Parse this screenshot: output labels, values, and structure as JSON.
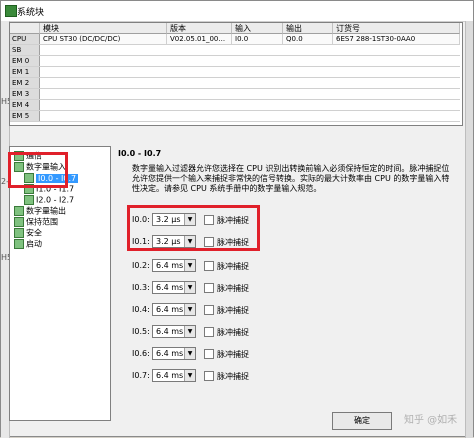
{
  "window": {
    "title": "系统块"
  },
  "left_edge": {
    "marks": [
      "H5",
      "2-",
      "H5"
    ]
  },
  "module_table": {
    "headers": [
      "模块",
      "版本",
      "输入",
      "输出",
      "订货号"
    ],
    "rows": [
      {
        "label": "CPU",
        "module": "CPU ST30 (DC/DC/DC)",
        "version": "V02.05.01_00...",
        "input": "I0.0",
        "output": "Q0.0",
        "order": "6ES7 288-1ST30-0AA0"
      },
      {
        "label": "SB",
        "module": "",
        "version": "",
        "input": "",
        "output": "",
        "order": ""
      },
      {
        "label": "EM 0",
        "module": "",
        "version": "",
        "input": "",
        "output": "",
        "order": ""
      },
      {
        "label": "EM 1",
        "module": "",
        "version": "",
        "input": "",
        "output": "",
        "order": ""
      },
      {
        "label": "EM 2",
        "module": "",
        "version": "",
        "input": "",
        "output": "",
        "order": ""
      },
      {
        "label": "EM 3",
        "module": "",
        "version": "",
        "input": "",
        "output": "",
        "order": ""
      },
      {
        "label": "EM 4",
        "module": "",
        "version": "",
        "input": "",
        "output": "",
        "order": ""
      },
      {
        "label": "EM 5",
        "module": "",
        "version": "",
        "input": "",
        "output": "",
        "order": ""
      }
    ]
  },
  "tree": {
    "items": [
      {
        "label": "通信"
      },
      {
        "label": "数字量输入"
      },
      {
        "label": "I0.0 - I0.7"
      },
      {
        "label": "I1.0 - I1.7"
      },
      {
        "label": "I2.0 - I2.7"
      },
      {
        "label": "数字量输出"
      },
      {
        "label": "保持范围"
      },
      {
        "label": "安全"
      },
      {
        "label": "启动"
      }
    ]
  },
  "panel": {
    "title": "I0.0 - I0.7",
    "description": "数字量输入过滤器允许您选择在 CPU 识别出转换前输入必须保持恒定的时间。脉冲捕捉位允许您提供一个输入来捕捉非常快的信号转换。实际的最大计数率由 CPU 的数字量输入特性决定。请参见 CPU 系统手册中的数字量输入规范。",
    "checkbox_label": "脉冲捕捉",
    "filters": [
      {
        "name": "I0.0:",
        "value": "3.2 μs"
      },
      {
        "name": "I0.1:",
        "value": "3.2 μs"
      },
      {
        "name": "I0.2:",
        "value": "6.4 ms"
      },
      {
        "name": "I0.3:",
        "value": "6.4 ms"
      },
      {
        "name": "I0.4:",
        "value": "6.4 ms"
      },
      {
        "name": "I0.5:",
        "value": "6.4 ms"
      },
      {
        "name": "I0.6:",
        "value": "6.4 ms"
      },
      {
        "name": "I0.7:",
        "value": "6.4 ms"
      }
    ]
  },
  "footer": {
    "ok_label": "确定"
  },
  "watermark": "知乎 @如禾"
}
